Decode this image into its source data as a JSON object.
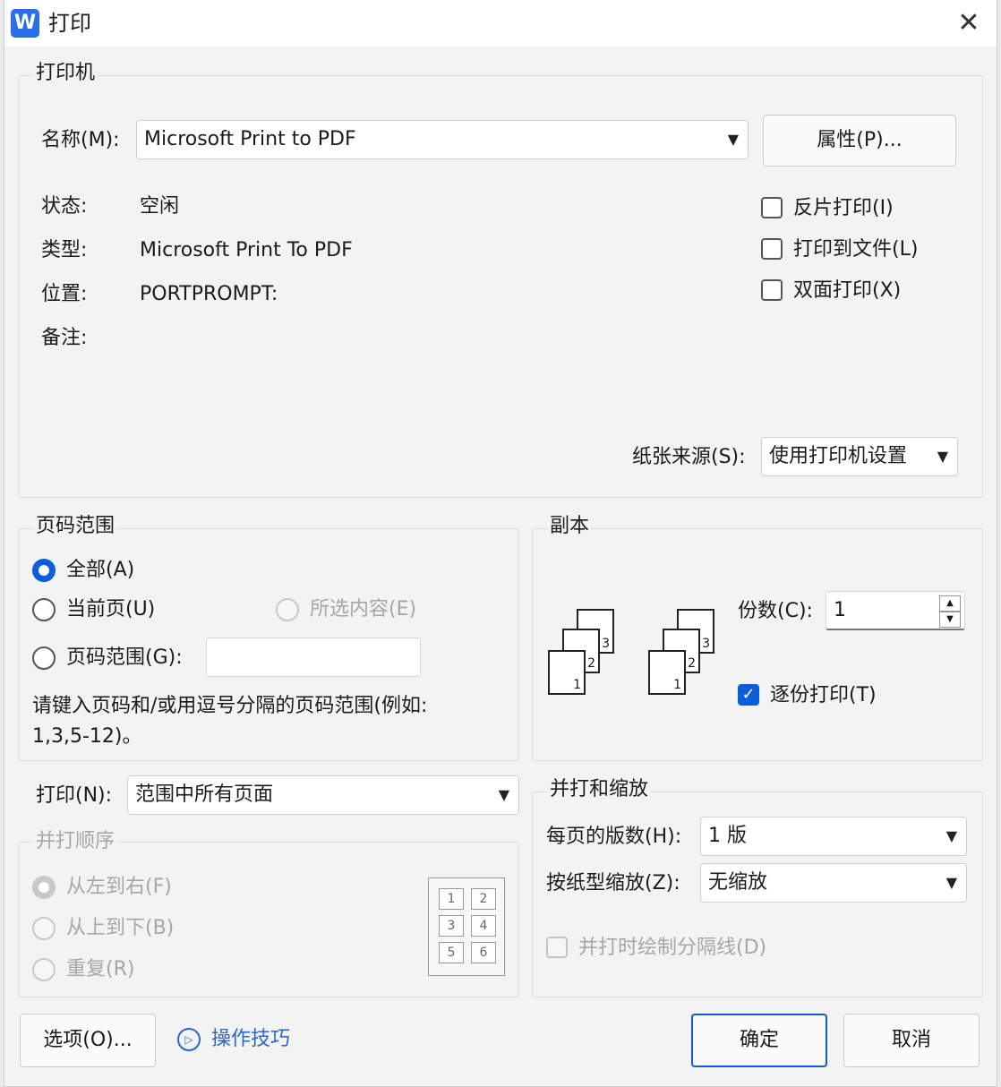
{
  "window": {
    "title": "打印",
    "app_icon": "W",
    "close_glyph": "✕"
  },
  "printer": {
    "legend": "打印机",
    "name_label": "名称(M):",
    "name_value": "Microsoft Print to PDF",
    "properties_button": "属性(P)...",
    "status_label": "状态:",
    "status_value": "空闲",
    "type_label": "类型:",
    "type_value": "Microsoft Print To PDF",
    "location_label": "位置:",
    "location_value": "PORTPROMPT:",
    "comment_label": "备注:",
    "options": [
      {
        "label": "反片打印(I)",
        "checked": false
      },
      {
        "label": "打印到文件(L)",
        "checked": false
      },
      {
        "label": "双面打印(X)",
        "checked": false
      }
    ],
    "paper_source_label": "纸张来源(S):",
    "paper_source_value": "使用打印机设置"
  },
  "page_range": {
    "legend": "页码范围",
    "all": "全部(A)",
    "current": "当前页(U)",
    "selection": "所选内容(E)",
    "range": "页码范围(G):",
    "range_value": "",
    "hint": "请键入页码和/或用逗号分隔的页码范围(例如:\n1,3,5-12)。",
    "selected": "all"
  },
  "copies": {
    "legend": "副本",
    "count_label": "份数(C):",
    "count_value": "1",
    "collate_label": "逐份打印(T)",
    "collate_checked": true
  },
  "print_what": {
    "label": "打印(N):",
    "value": "范围中所有页面"
  },
  "order": {
    "legend": "并打顺序",
    "left_right": "从左到右(F)",
    "top_bottom": "从上到下(B)",
    "repeat": "重复(R)",
    "grid": [
      "1",
      "2",
      "3",
      "4",
      "5",
      "6"
    ]
  },
  "zoom": {
    "legend": "并打和缩放",
    "pages_per_sheet_label": "每页的版数(H):",
    "pages_per_sheet_value": "1 版",
    "scale_label": "按纸型缩放(Z):",
    "scale_value": "无缩放",
    "draw_borders_label": "并打时绘制分隔线(D)"
  },
  "footer": {
    "options_button": "选项(O)...",
    "tips_link": "操作技巧",
    "ok_button": "确定",
    "cancel_button": "取消"
  },
  "colors": {
    "accent": "#0b5ed7",
    "link": "#2a66cc"
  }
}
